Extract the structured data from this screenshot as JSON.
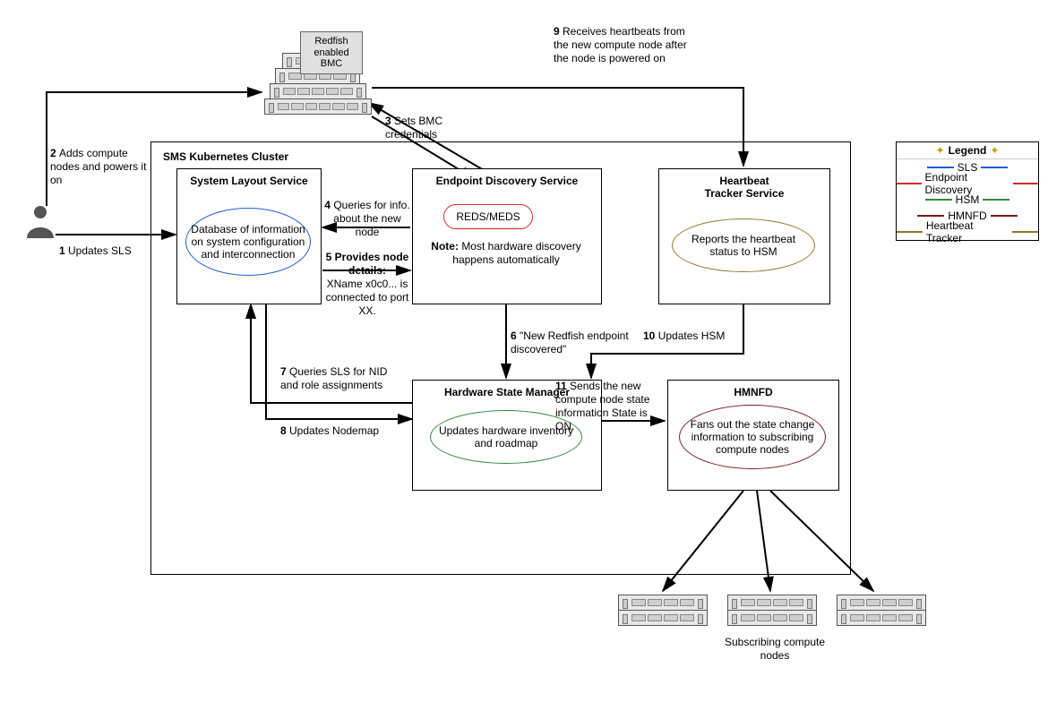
{
  "cluster_title": "SMS Kubernetes Cluster",
  "bmc_label": "Redfish\nenabled\nBMC",
  "sls": {
    "title": "System Layout Service",
    "desc": "Database of information on system configuration and interconnection"
  },
  "eds": {
    "title": "Endpoint Discovery Service",
    "pill": "REDS/MEDS",
    "note_label": "Note:",
    "note": "Most hardware discovery happens automatically"
  },
  "hts": {
    "title": "Heartbeat Tracker Service",
    "desc": "Reports the heartbeat status to HSM"
  },
  "hsm": {
    "title": "Hardware State Manager",
    "desc": "Updates hardware inventory and roadmap"
  },
  "hmnfd": {
    "title": "HMNFD",
    "desc": "Fans out the state change information to subscribing compute nodes"
  },
  "subscribing_label": "Subscribing compute nodes",
  "steps": {
    "s1": "Updates SLS",
    "s2": "Adds compute nodes and powers it on",
    "s3": "Sets BMC credentials",
    "s4": "Queries for info. about the new node",
    "s5a": "Provides node details:",
    "s5b": "XName x0c0... is connected to port XX.",
    "s6": "\"New Redfish endpoint discovered\"",
    "s7": "Queries SLS for NID and role assignments",
    "s8": "Updates Nodemap",
    "s9": "Receives heartbeats from the new compute node after the node is powered on",
    "s10": "Updates HSM",
    "s11": "Sends the new compute node state information State is ON."
  },
  "legend": {
    "title": "Legend",
    "items": [
      {
        "label": "SLS",
        "color": "#1f5fd6"
      },
      {
        "label": "Endpoint Discovery",
        "color": "#d62d2d"
      },
      {
        "label": "HSM",
        "color": "#2e8b3e"
      },
      {
        "label": "HMNFD",
        "color": "#7a1c1c"
      },
      {
        "label": "Heartbeat Tracker",
        "color": "#8a7a2a"
      }
    ]
  },
  "colors": {
    "sls": "#1f5fd6",
    "eds": "#d62d2d",
    "hsm": "#2e8b3e",
    "hmnfd": "#7a1c1c",
    "hts": "#8a7a2a"
  }
}
